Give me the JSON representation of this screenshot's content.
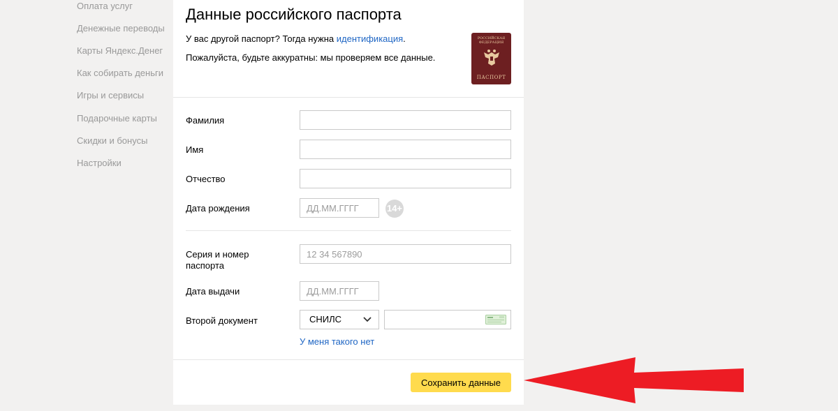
{
  "sidebar": {
    "items": [
      {
        "label": "Оплата услуг"
      },
      {
        "label": "Денежные переводы"
      },
      {
        "label": "Карты Яндекс.Денег"
      },
      {
        "label": "Как собирать деньги"
      },
      {
        "label": "Игры и сервисы"
      },
      {
        "label": "Подарочные карты"
      },
      {
        "label": "Скидки и бонусы"
      },
      {
        "label": "Настройки"
      }
    ]
  },
  "form": {
    "title": "Данные российского паспорта",
    "intro_prefix": "У вас другой паспорт? Тогда нужна ",
    "intro_link": "идентификация",
    "intro_suffix": ".",
    "intro_note": "Пожалуйста, будьте аккуратны: мы проверяем все данные.",
    "passport_image": {
      "top_text": "РОССИЙСКАЯ ФЕДЕРАЦИЯ",
      "bottom_text": "ПАСПОРТ",
      "icon": "double-headed-eagle-icon"
    },
    "fields": {
      "surname": {
        "label": "Фамилия",
        "value": ""
      },
      "name": {
        "label": "Имя",
        "value": ""
      },
      "patronymic": {
        "label": "Отчество",
        "value": ""
      },
      "birth_date": {
        "label": "Дата рождения",
        "placeholder": "ДД.ММ.ГГГГ",
        "badge": "14+"
      },
      "passport_number": {
        "label": "Серия и номер паспорта",
        "placeholder": "12 34 567890"
      },
      "issue_date": {
        "label": "Дата выдачи",
        "placeholder": "ДД.ММ.ГГГГ"
      },
      "second_document": {
        "label": "Второй документ",
        "selected": "СНИЛС",
        "value": "",
        "no_document_link": "У меня такого нет"
      }
    },
    "save_label": "Сохранить данные"
  },
  "colors": {
    "page_bg": "#f2f1f0",
    "link": "#1f66c4",
    "button": "#ffdb4d",
    "arrow": "#ed1c24",
    "passport_cover": "#6d1f21"
  }
}
